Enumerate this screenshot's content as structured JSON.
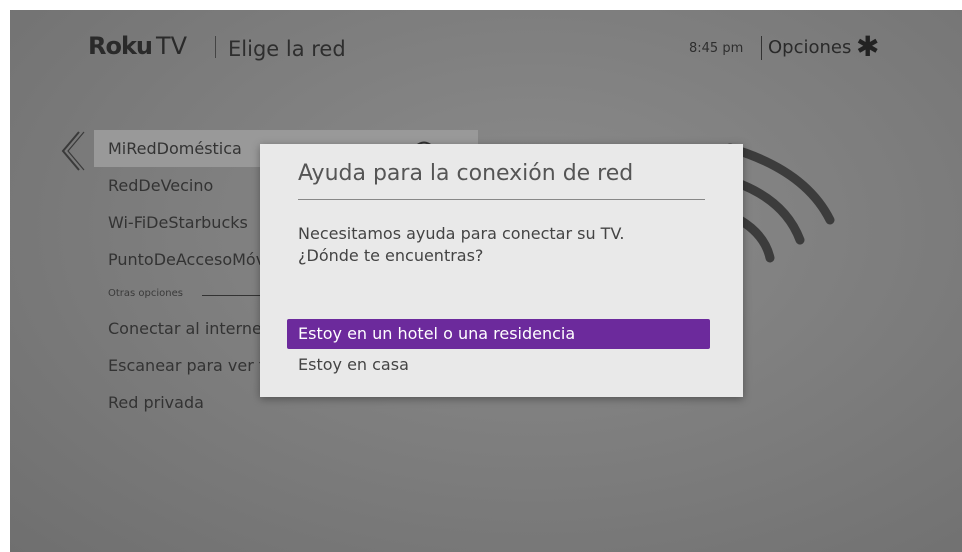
{
  "header": {
    "logo_brand": "Roku",
    "logo_tv": "TV",
    "page_title": "Elige la red",
    "clock": "8:45 pm",
    "options_label": "Opciones",
    "options_icon": "asterisk-icon"
  },
  "networks": [
    "MiRedDoméstica",
    "RedDeVecino",
    "Wi-FiDeStarbucks",
    "PuntoDeAccesoMóvil"
  ],
  "other_options": {
    "label": "Otras opciones",
    "items": [
      "Conectar al internet",
      "Escanear para ver todas las redes",
      "Red privada"
    ]
  },
  "dialog": {
    "title": "Ayuda para la conexión de red",
    "message_line1": "Necesitamos ayuda para conectar su TV.",
    "message_line2": "¿Dónde te encuentras?",
    "choices": [
      "Estoy en un hotel o una residencia",
      "Estoy en casa"
    ],
    "selected_index": 0
  },
  "colors": {
    "accent_purple": "#6c2a9c",
    "overlay_gray": "#7c7c7c",
    "dialog_bg": "#e9e9e9"
  }
}
